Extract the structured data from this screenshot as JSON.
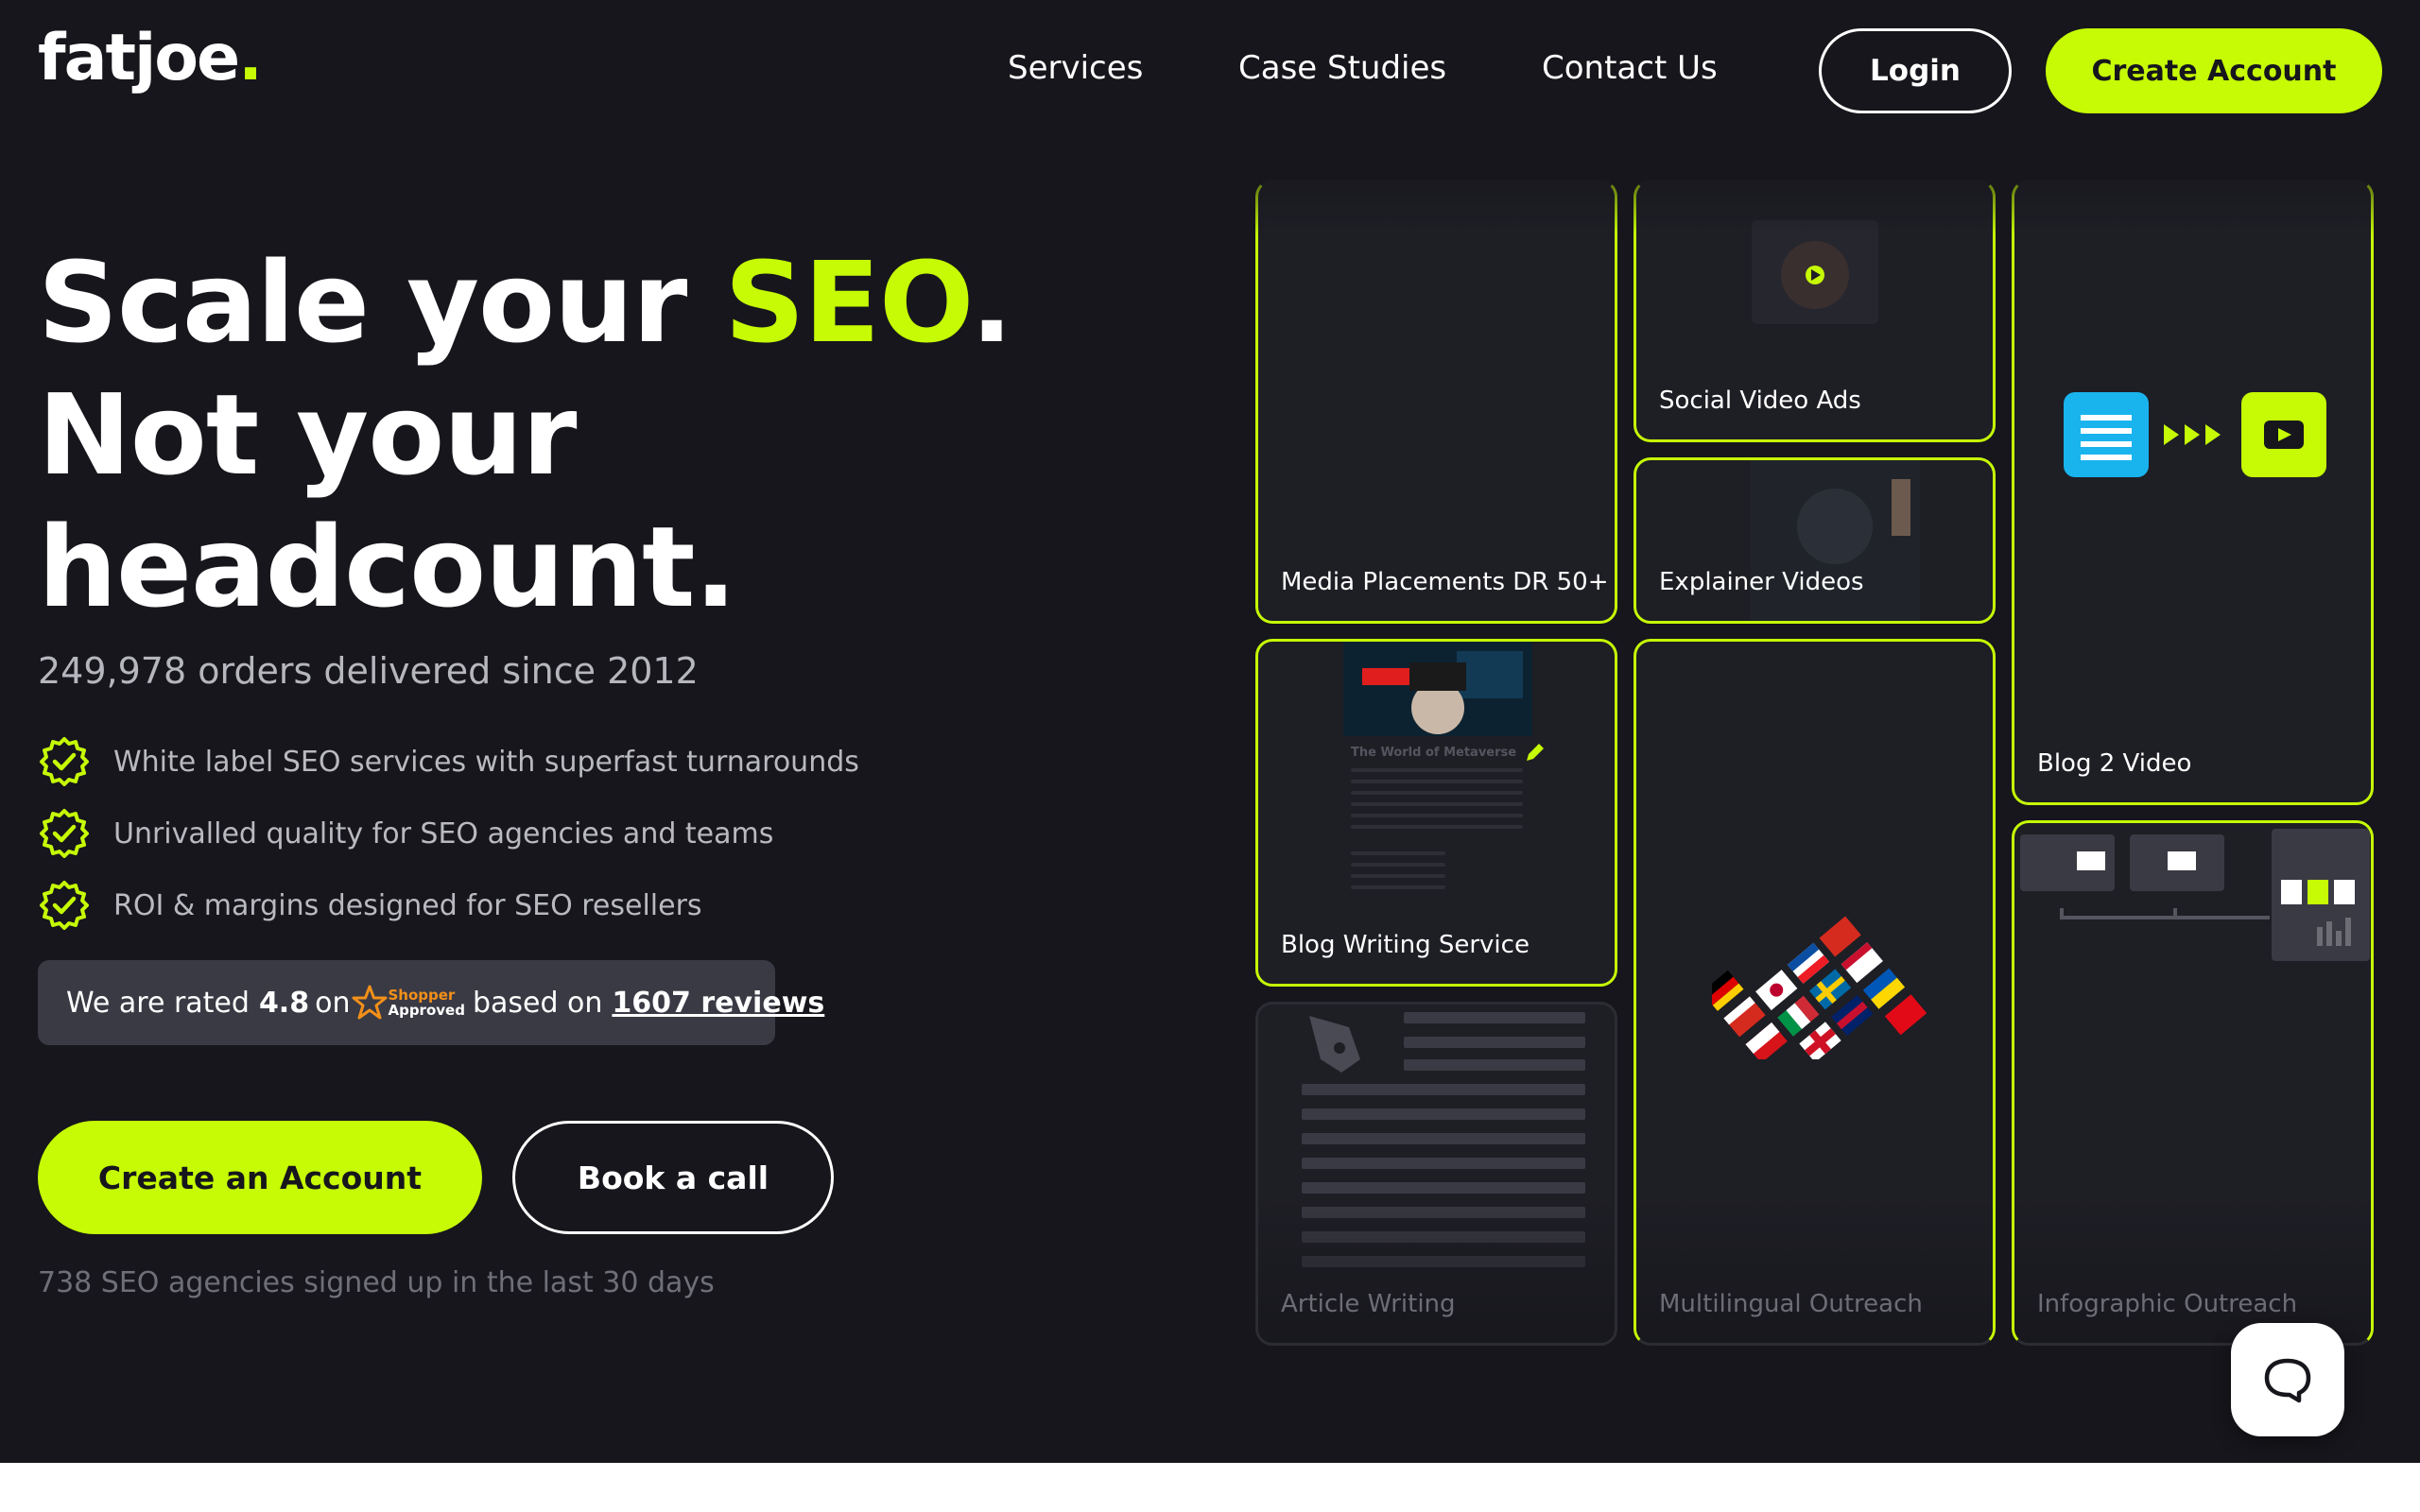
{
  "header": {
    "logo_text": "fatjoe",
    "logo_dot": ".",
    "nav": [
      "Services",
      "Case Studies",
      "Contact Us"
    ],
    "login_label": "Login",
    "create_label": "Create Account"
  },
  "hero": {
    "title_line1_pre": "Scale your ",
    "title_line1_accent": "SEO",
    "title_line1_post": ".",
    "title_line2": "Not your",
    "title_line3": "headcount.",
    "orders_text": "249,978 orders delivered since 2012",
    "bullets": [
      "White label SEO services with superfast turnarounds",
      "Unrivalled quality for SEO agencies and teams",
      "ROI & margins designed for SEO resellers"
    ],
    "rating": {
      "prefix": "We are rated",
      "score": "4.8",
      "on": "on",
      "badge_top": "Shopper",
      "badge_bottom": "Approved",
      "based": "based on",
      "reviews": "1607 reviews"
    },
    "cta_primary": "Create an Account",
    "cta_secondary": "Book a call",
    "signed_up": "738 SEO agencies signed up in the last 30 days"
  },
  "services": [
    "Media Placements DR 50+",
    "Social Video Ads",
    "Explainer Videos",
    "Blog 2 Video",
    "Blog Writing Service",
    "Multilingual Outreach",
    "Infographic Outreach",
    "Article Writing"
  ],
  "blog_preview": {
    "heading": "The World of Metaverse"
  },
  "colors": {
    "accent": "#c6fa05",
    "background": "#16161c",
    "card": "#1e1e25",
    "rating_box": "#3a3a45"
  },
  "icons": [
    "check-badge-icon",
    "shopper-approved-star-icon",
    "document-icon",
    "play-icon",
    "pen-nib-icon",
    "chat-bubble-icon"
  ]
}
